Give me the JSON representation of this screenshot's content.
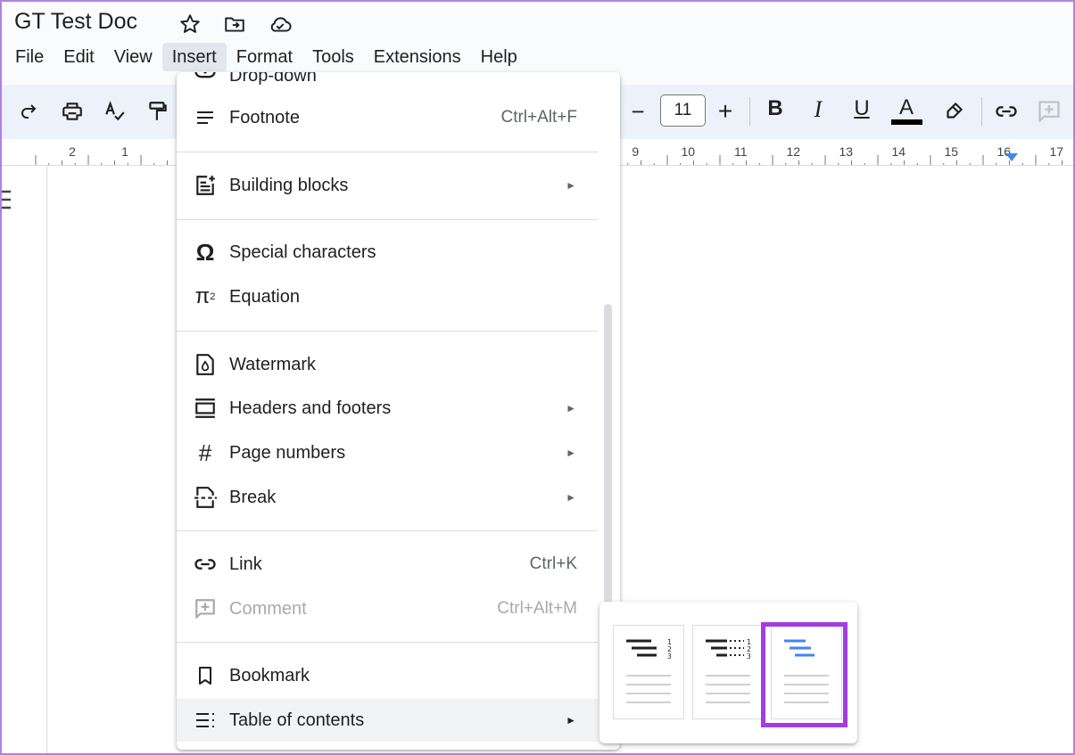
{
  "app": {
    "doc_title": "GT Test Doc",
    "menus": [
      "File",
      "Edit",
      "View",
      "Insert",
      "Format",
      "Tools",
      "Extensions",
      "Help"
    ],
    "active_menu": "Insert"
  },
  "toolbar": {
    "font_size": "11",
    "bold": "B",
    "italic": "I",
    "underline": "U",
    "text_color": "A",
    "minus": "−",
    "plus": "+"
  },
  "ruler": {
    "left_labels": [
      "2",
      "1"
    ],
    "right_labels": [
      "9",
      "10",
      "11",
      "12",
      "13",
      "14",
      "15",
      "16",
      "17"
    ]
  },
  "insert_menu": {
    "partial_top_item": "Drop-down",
    "items": [
      {
        "label": "Footnote",
        "shortcut": "Ctrl+Alt+F",
        "icon": "footnote-icon"
      },
      {
        "label": "Building blocks",
        "submenu": true,
        "icon": "building-blocks-icon"
      },
      {
        "label": "Special characters",
        "icon": "omega-icon"
      },
      {
        "label": "Equation",
        "icon": "pi-icon"
      },
      {
        "label": "Watermark",
        "icon": "watermark-icon"
      },
      {
        "label": "Headers and footers",
        "submenu": true,
        "icon": "headers-footers-icon"
      },
      {
        "label": "Page numbers",
        "submenu": true,
        "icon": "hash-icon"
      },
      {
        "label": "Break",
        "submenu": true,
        "icon": "break-icon"
      },
      {
        "label": "Link",
        "shortcut": "Ctrl+K",
        "icon": "link-icon"
      },
      {
        "label": "Comment",
        "shortcut": "Ctrl+Alt+M",
        "disabled": true,
        "icon": "comment-icon"
      },
      {
        "label": "Bookmark",
        "icon": "bookmark-icon"
      },
      {
        "label": "Table of contents",
        "submenu": true,
        "highlighted": true,
        "icon": "toc-icon"
      }
    ],
    "arrow_glyph": "►"
  },
  "toc_submenu": {
    "options": [
      {
        "id": "plain-text-numbers",
        "numbers": [
          "1",
          "2",
          "3"
        ]
      },
      {
        "id": "dotted-numbers",
        "numbers": [
          "1",
          "2",
          "3"
        ]
      },
      {
        "id": "blue-links",
        "selected": true
      }
    ]
  },
  "colors": {
    "accent_highlight": "#a33ce6",
    "link_blue": "#4285f4",
    "toolbar_bg": "#edf2fa"
  }
}
